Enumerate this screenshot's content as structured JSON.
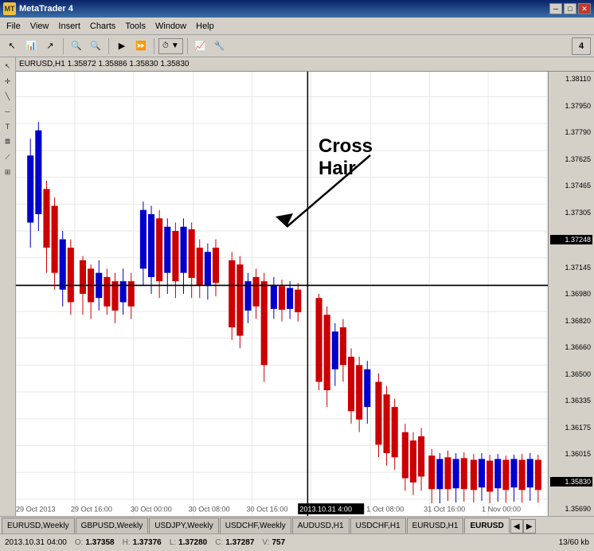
{
  "titleBar": {
    "title": "MetaTrader 4",
    "icon": "MT"
  },
  "menuBar": {
    "items": [
      "File",
      "View",
      "Insert",
      "Charts",
      "Tools",
      "Window",
      "Help"
    ]
  },
  "chart": {
    "header": "EURUSD,H1  1.35872  1.35886  1.35830  1.35830",
    "symbol": "EURUSD",
    "timeframe": "H1",
    "open": "1.35872",
    "high": "1.35886",
    "low": "1.35830",
    "close": "1.35830",
    "crosshairLabel": "Cross Hair",
    "priceLabels": [
      "1.38110",
      "1.37950",
      "1.37790",
      "1.37625",
      "1.37465",
      "1.37305",
      "1.37248",
      "1.37145",
      "1.36980",
      "1.36820",
      "1.36660",
      "1.36500",
      "1.36335",
      "1.36175",
      "1.36015",
      "1.35830",
      "1.35690"
    ],
    "highlightedPrice": "1.37248",
    "currentPrice": "1.35830",
    "xLabels": [
      "29 Oct 2013",
      "29 Oct 16:00",
      "30 Oct 00:00",
      "30 Oct 08:00",
      "30 Oct 16:00",
      "2013.10.31 4:00",
      "1 Oct 08:00",
      "31 Oct 16:00",
      "1 Nov 00:00"
    ]
  },
  "tabs": [
    {
      "label": "EURUSD,Weekly",
      "active": false
    },
    {
      "label": "GBPUSD,Weekly",
      "active": false
    },
    {
      "label": "USDJPY,Weekly",
      "active": false
    },
    {
      "label": "USDCHF,Weekly",
      "active": false
    },
    {
      "label": "AUDUSD,H1",
      "active": false
    },
    {
      "label": "USDCHF,H1",
      "active": false
    },
    {
      "label": "EURUSD,H1",
      "active": false
    },
    {
      "label": "EURUSD",
      "active": true
    }
  ],
  "statusBar": {
    "datetime": "2013.10.31 04:00",
    "open_label": "O:",
    "open": "1.37358",
    "high_label": "H:",
    "high": "1.37376",
    "low_label": "L:",
    "low": "1.37280",
    "close_label": "C:",
    "close": "1.37287",
    "volume_label": "V:",
    "volume": "757",
    "size": "13/60 kb"
  },
  "toolbar": {
    "cornerNum": "4"
  }
}
